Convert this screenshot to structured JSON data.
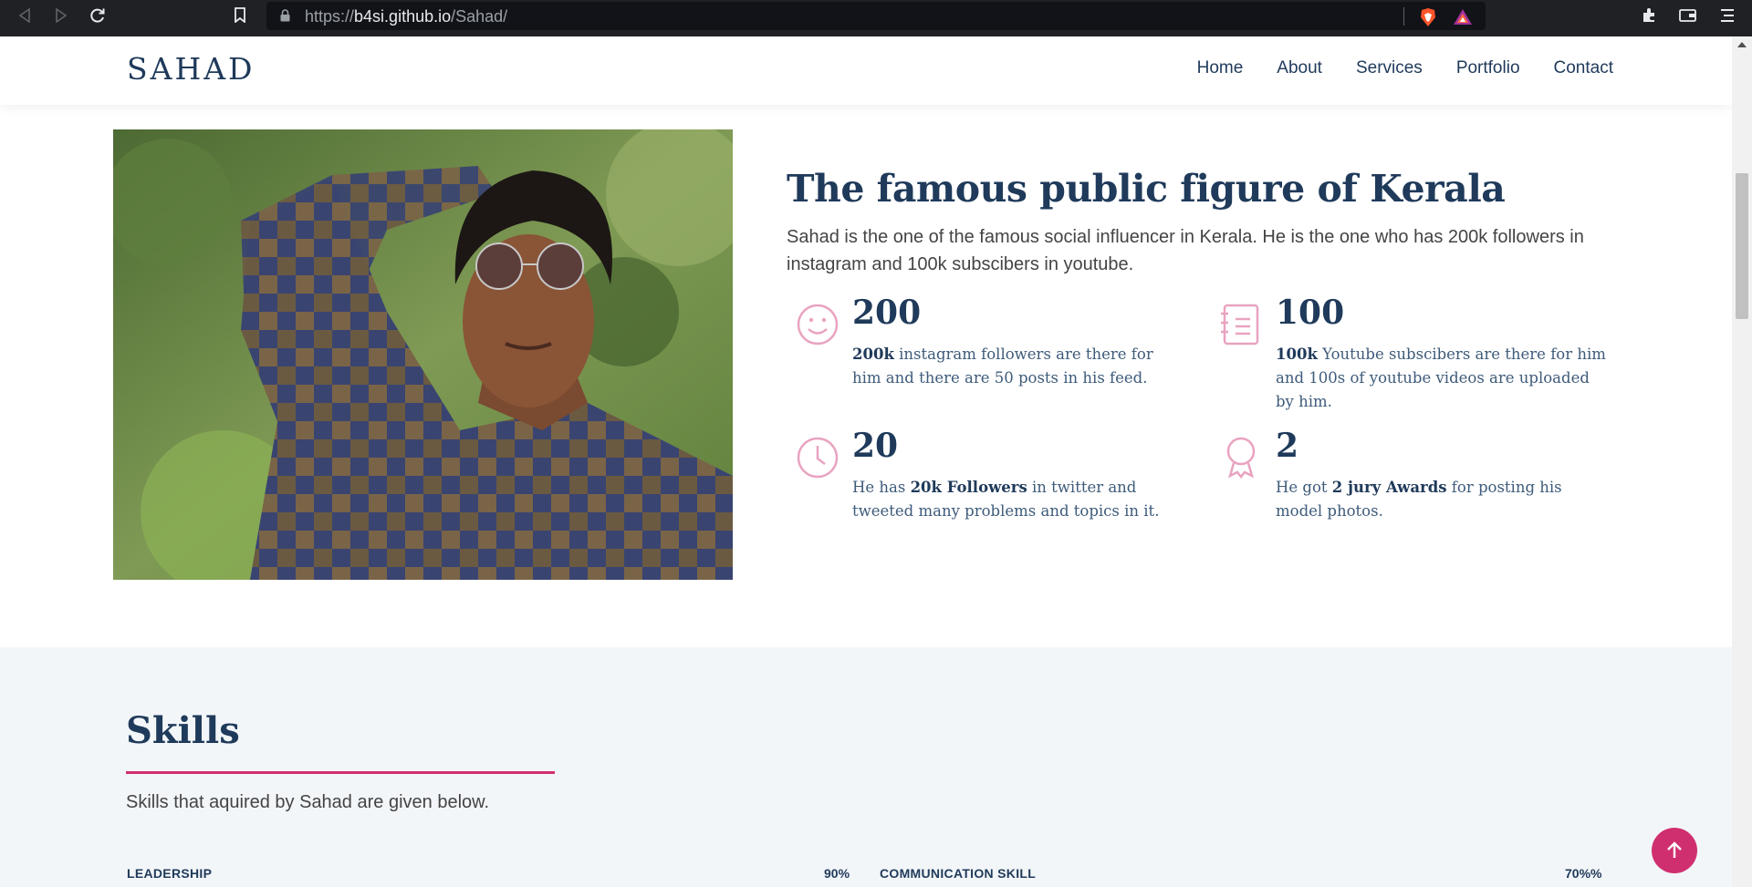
{
  "browser": {
    "url_scheme": "https://",
    "url_host": "b4si.github.io",
    "url_path": "/Sahad/",
    "icons": [
      "back-icon",
      "forward-icon",
      "reload-icon",
      "bookmark-icon",
      "lock-icon",
      "brave-shield-icon",
      "brave-rewards-icon",
      "extensions-icon",
      "wallet-icon",
      "menu-icon"
    ]
  },
  "header": {
    "logo": "SAHAD",
    "menu": [
      "Home",
      "About",
      "Services",
      "Portfolio",
      "Contact"
    ]
  },
  "about": {
    "photo_alt": "Portrait photo",
    "title": "The famous public figure of Kerala",
    "lead": "Sahad is the one of the famous social influencer in Kerala. He is the one who has 200k followers in instagram and 100k subscibers in youtube.",
    "stats": [
      {
        "icon": "smiley-icon",
        "number": "200",
        "bold": "200k",
        "text": " instagram followers are there for him and there are 50 posts in his feed."
      },
      {
        "icon": "document-chart-icon",
        "number": "100",
        "bold": "100k",
        "text": " Youtube subscibers are there for him and 100s of youtube videos are uploaded by him."
      },
      {
        "icon": "clock-icon",
        "number": "20",
        "pre": "He has ",
        "bold": "20k Followers",
        "text": " in twitter and tweeted many problems and topics in it."
      },
      {
        "icon": "award-icon",
        "number": "2",
        "pre": "He got ",
        "bold": "2 jury Awards",
        "text": " for posting his model photos."
      }
    ]
  },
  "skills": {
    "title": "Skills",
    "subtitle": "Skills that aquired by Sahad are given below.",
    "items": [
      {
        "name": "LEADERSHIP",
        "percent_label": "90%",
        "value": 90
      },
      {
        "name": "COMMUNICATION SKILL",
        "percent_label": "70%%",
        "value": 70
      }
    ]
  },
  "colors": {
    "accent": "#d02f6f",
    "navy": "#1f3a5a",
    "icon_pink": "#e9a3c0"
  }
}
